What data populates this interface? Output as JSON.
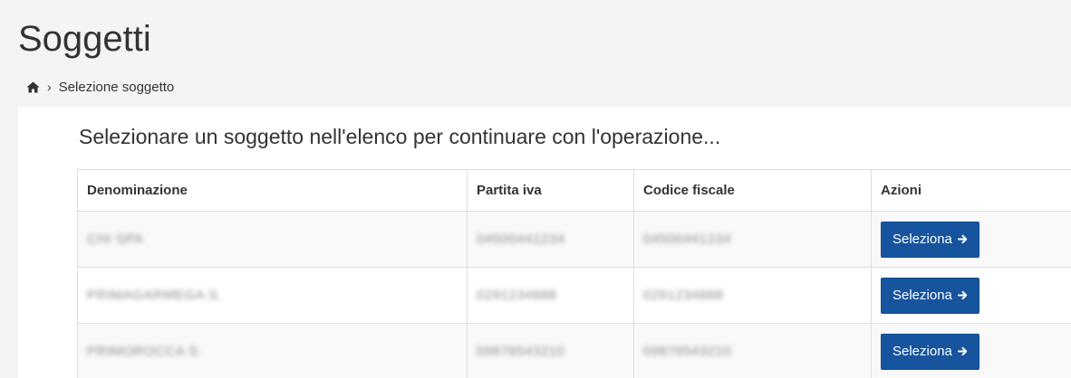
{
  "header": {
    "title": "Soggetti",
    "breadcrumb": {
      "separator": "›",
      "current": "Selezione soggetto"
    }
  },
  "main": {
    "intro": "Selezionare un soggetto nell'elenco per continuare con l'operazione...",
    "table": {
      "columns": [
        "Denominazione",
        "Partita iva",
        "Codice fiscale",
        "Azioni"
      ],
      "rows": [
        {
          "denominazione": "CHI SPA",
          "partita_iva": "04500441234",
          "codice_fiscale": "04500441234",
          "action_label": "Seleziona"
        },
        {
          "denominazione": "PRIMAGARMEGA S.",
          "partita_iva": "0291234888",
          "codice_fiscale": "0291234888",
          "action_label": "Seleziona"
        },
        {
          "denominazione": "PRIMOROCCA S.",
          "partita_iva": "09876543210",
          "codice_fiscale": "09876543210",
          "action_label": "Seleziona"
        }
      ]
    }
  },
  "icons": {
    "home": "home-icon",
    "arrow": "arrow-right-icon"
  },
  "colors": {
    "accent": "#17549e",
    "page_background": "#f4f4f4",
    "border": "#dddddd"
  }
}
